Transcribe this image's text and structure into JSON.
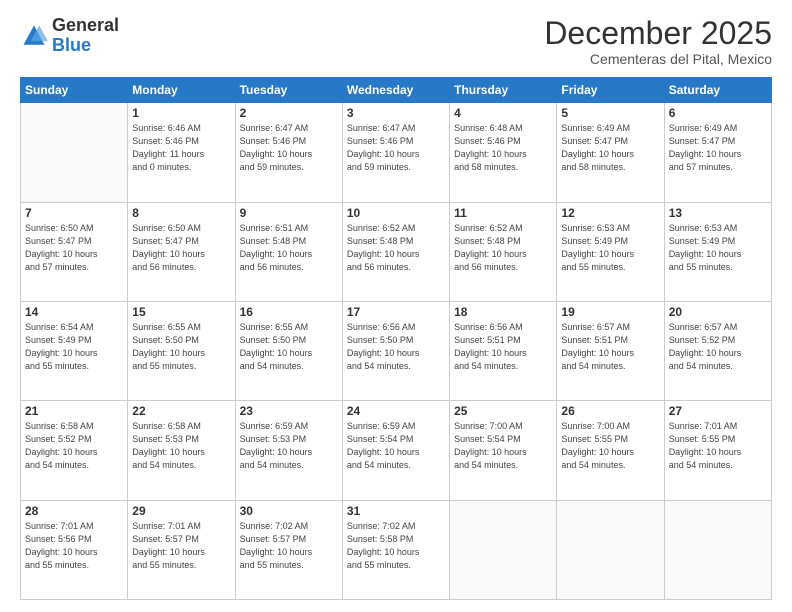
{
  "header": {
    "logo_general": "General",
    "logo_blue": "Blue",
    "month": "December 2025",
    "location": "Cementeras del Pital, Mexico"
  },
  "days_of_week": [
    "Sunday",
    "Monday",
    "Tuesday",
    "Wednesday",
    "Thursday",
    "Friday",
    "Saturday"
  ],
  "weeks": [
    [
      {
        "day": "",
        "info": ""
      },
      {
        "day": "1",
        "info": "Sunrise: 6:46 AM\nSunset: 5:46 PM\nDaylight: 11 hours\nand 0 minutes."
      },
      {
        "day": "2",
        "info": "Sunrise: 6:47 AM\nSunset: 5:46 PM\nDaylight: 10 hours\nand 59 minutes."
      },
      {
        "day": "3",
        "info": "Sunrise: 6:47 AM\nSunset: 5:46 PM\nDaylight: 10 hours\nand 59 minutes."
      },
      {
        "day": "4",
        "info": "Sunrise: 6:48 AM\nSunset: 5:46 PM\nDaylight: 10 hours\nand 58 minutes."
      },
      {
        "day": "5",
        "info": "Sunrise: 6:49 AM\nSunset: 5:47 PM\nDaylight: 10 hours\nand 58 minutes."
      },
      {
        "day": "6",
        "info": "Sunrise: 6:49 AM\nSunset: 5:47 PM\nDaylight: 10 hours\nand 57 minutes."
      }
    ],
    [
      {
        "day": "7",
        "info": "Sunrise: 6:50 AM\nSunset: 5:47 PM\nDaylight: 10 hours\nand 57 minutes."
      },
      {
        "day": "8",
        "info": "Sunrise: 6:50 AM\nSunset: 5:47 PM\nDaylight: 10 hours\nand 56 minutes."
      },
      {
        "day": "9",
        "info": "Sunrise: 6:51 AM\nSunset: 5:48 PM\nDaylight: 10 hours\nand 56 minutes."
      },
      {
        "day": "10",
        "info": "Sunrise: 6:52 AM\nSunset: 5:48 PM\nDaylight: 10 hours\nand 56 minutes."
      },
      {
        "day": "11",
        "info": "Sunrise: 6:52 AM\nSunset: 5:48 PM\nDaylight: 10 hours\nand 56 minutes."
      },
      {
        "day": "12",
        "info": "Sunrise: 6:53 AM\nSunset: 5:49 PM\nDaylight: 10 hours\nand 55 minutes."
      },
      {
        "day": "13",
        "info": "Sunrise: 6:53 AM\nSunset: 5:49 PM\nDaylight: 10 hours\nand 55 minutes."
      }
    ],
    [
      {
        "day": "14",
        "info": "Sunrise: 6:54 AM\nSunset: 5:49 PM\nDaylight: 10 hours\nand 55 minutes."
      },
      {
        "day": "15",
        "info": "Sunrise: 6:55 AM\nSunset: 5:50 PM\nDaylight: 10 hours\nand 55 minutes."
      },
      {
        "day": "16",
        "info": "Sunrise: 6:55 AM\nSunset: 5:50 PM\nDaylight: 10 hours\nand 54 minutes."
      },
      {
        "day": "17",
        "info": "Sunrise: 6:56 AM\nSunset: 5:50 PM\nDaylight: 10 hours\nand 54 minutes."
      },
      {
        "day": "18",
        "info": "Sunrise: 6:56 AM\nSunset: 5:51 PM\nDaylight: 10 hours\nand 54 minutes."
      },
      {
        "day": "19",
        "info": "Sunrise: 6:57 AM\nSunset: 5:51 PM\nDaylight: 10 hours\nand 54 minutes."
      },
      {
        "day": "20",
        "info": "Sunrise: 6:57 AM\nSunset: 5:52 PM\nDaylight: 10 hours\nand 54 minutes."
      }
    ],
    [
      {
        "day": "21",
        "info": "Sunrise: 6:58 AM\nSunset: 5:52 PM\nDaylight: 10 hours\nand 54 minutes."
      },
      {
        "day": "22",
        "info": "Sunrise: 6:58 AM\nSunset: 5:53 PM\nDaylight: 10 hours\nand 54 minutes."
      },
      {
        "day": "23",
        "info": "Sunrise: 6:59 AM\nSunset: 5:53 PM\nDaylight: 10 hours\nand 54 minutes."
      },
      {
        "day": "24",
        "info": "Sunrise: 6:59 AM\nSunset: 5:54 PM\nDaylight: 10 hours\nand 54 minutes."
      },
      {
        "day": "25",
        "info": "Sunrise: 7:00 AM\nSunset: 5:54 PM\nDaylight: 10 hours\nand 54 minutes."
      },
      {
        "day": "26",
        "info": "Sunrise: 7:00 AM\nSunset: 5:55 PM\nDaylight: 10 hours\nand 54 minutes."
      },
      {
        "day": "27",
        "info": "Sunrise: 7:01 AM\nSunset: 5:55 PM\nDaylight: 10 hours\nand 54 minutes."
      }
    ],
    [
      {
        "day": "28",
        "info": "Sunrise: 7:01 AM\nSunset: 5:56 PM\nDaylight: 10 hours\nand 55 minutes."
      },
      {
        "day": "29",
        "info": "Sunrise: 7:01 AM\nSunset: 5:57 PM\nDaylight: 10 hours\nand 55 minutes."
      },
      {
        "day": "30",
        "info": "Sunrise: 7:02 AM\nSunset: 5:57 PM\nDaylight: 10 hours\nand 55 minutes."
      },
      {
        "day": "31",
        "info": "Sunrise: 7:02 AM\nSunset: 5:58 PM\nDaylight: 10 hours\nand 55 minutes."
      },
      {
        "day": "",
        "info": ""
      },
      {
        "day": "",
        "info": ""
      },
      {
        "day": "",
        "info": ""
      }
    ]
  ]
}
